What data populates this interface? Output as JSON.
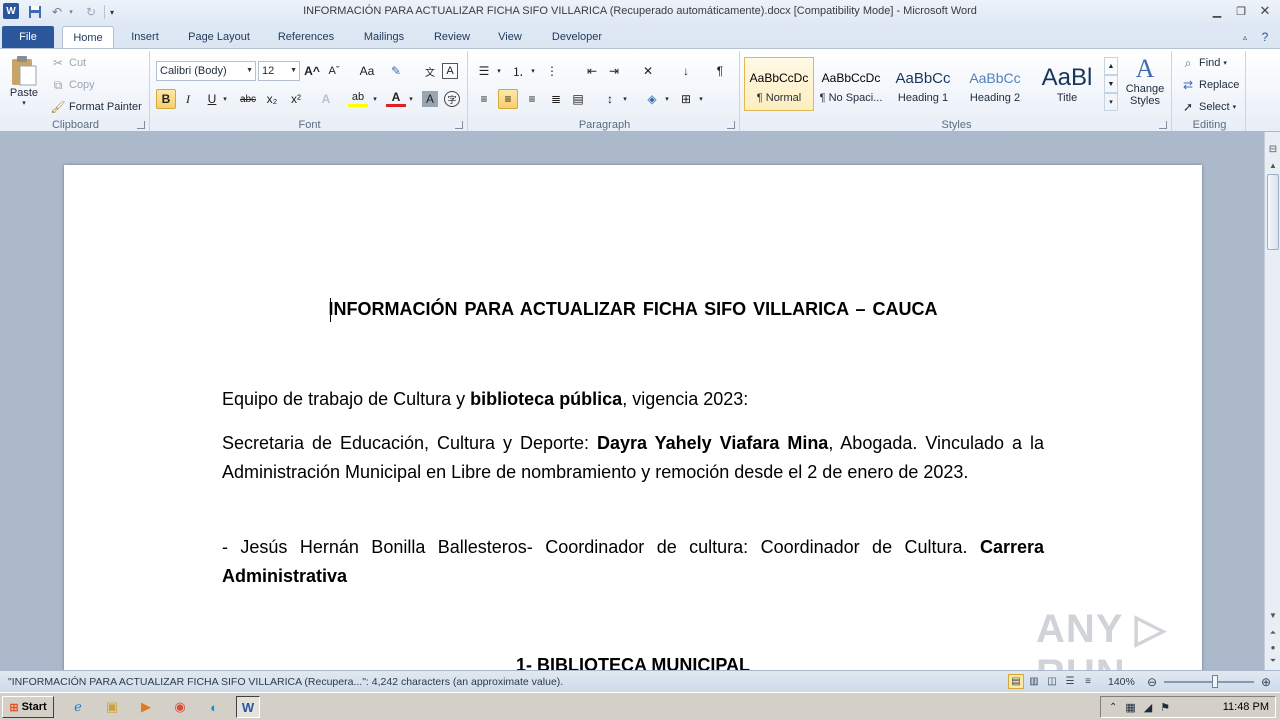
{
  "window": {
    "title": "INFORMACIÓN PARA ACTUALIZAR FICHA SIFO VILLARICA (Recuperado automáticamente).docx [Compatibility Mode]  -  Microsoft Word",
    "app_icon": "W"
  },
  "tabs": [
    "File",
    "Home",
    "Insert",
    "Page Layout",
    "References",
    "Mailings",
    "Review",
    "View",
    "Developer"
  ],
  "clipboard": {
    "paste": "Paste",
    "cut": "Cut",
    "copy": "Copy",
    "format_painter": "Format Painter",
    "label": "Clipboard"
  },
  "font": {
    "name": "Calibri (Body)",
    "size": "12",
    "label": "Font",
    "bold": "B",
    "italic": "I",
    "underline": "U",
    "strike": "abc",
    "subscript": "x₂",
    "superscript": "x²",
    "grow": "A^",
    "shrink": "Aˇ",
    "case": "Aa",
    "clear": "A",
    "highlight": "ab",
    "color": "A",
    "shade": "A",
    "enclose": "字"
  },
  "paragraph": {
    "label": "Paragraph"
  },
  "styles": {
    "label": "Styles",
    "items": [
      {
        "preview": "AaBbCcDc",
        "name": "¶ Normal"
      },
      {
        "preview": "AaBbCcDc",
        "name": "¶ No Spaci..."
      },
      {
        "preview": "AaBbCc",
        "name": "Heading 1"
      },
      {
        "preview": "AaBbCc",
        "name": "Heading 2"
      },
      {
        "preview": "AaBl",
        "name": "Title"
      }
    ],
    "change_styles": "Change Styles"
  },
  "editing": {
    "label": "Editing",
    "find": "Find",
    "replace": "Replace",
    "select": "Select"
  },
  "document": {
    "heading": "INFORMACIÓN  PARA  ACTUALIZAR  FICHA SIFO VILLARICA  – CAUCA",
    "p1_a": "Equipo de trabajo de Cultura y ",
    "p1_b": "biblioteca pública",
    "p1_c": ", vigencia 2023:",
    "p2_a": "Secretaria  de  Educación,  Cultura  y  Deporte: ",
    "p2_b": "Dayra  Yahely  Viafara  Mina",
    "p2_c": ",  Abogada. Vinculado a la Administración Municipal en Libre de nombramiento y remoción desde el 2 de enero de 2023.",
    "p3_a": "-  Jesús  Hernán  Bonilla  Ballesteros-  Coordinador  de  cultura:  Coordinador  de  Cultura. ",
    "p3_b": "Carrera Administrativa",
    "section": "1- BIBLIOTECA MUNICIPAL"
  },
  "watermark": "ANY ▷ RUN",
  "status": {
    "text": "\"INFORMACIÓN PARA ACTUALIZAR FICHA SIFO VILLARICA (Recupera...\": 4,242 characters (an approximate value).",
    "zoom": "140%"
  },
  "taskbar": {
    "start": "Start",
    "clock": "11:48 PM"
  }
}
